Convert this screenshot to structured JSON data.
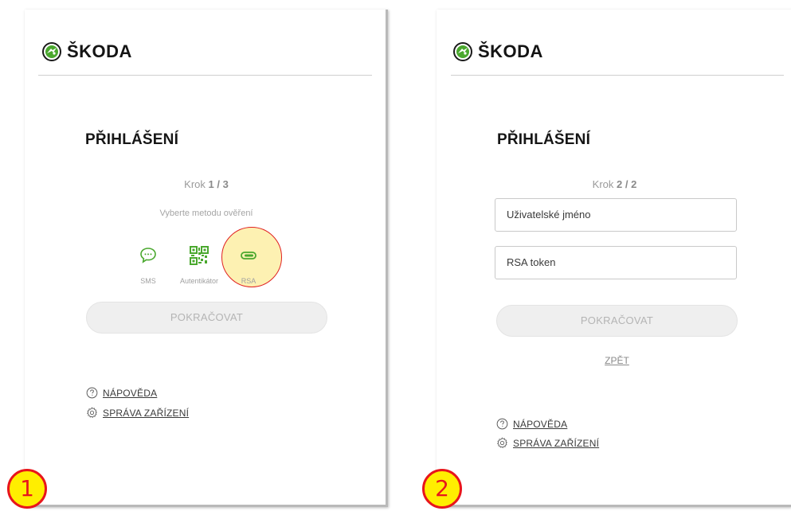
{
  "brand": {
    "name": "ŠKODA",
    "icon": "skoda-winged-arrow-logo",
    "colors": {
      "logo_green": "#3c8a28",
      "text": "#141414"
    }
  },
  "screen1": {
    "title": "PŘIHLÁŠENÍ",
    "step_prefix": "Krok",
    "step_value": "1 / 3",
    "instruction": "Vyberte metodu ověření",
    "methods": [
      {
        "label": "SMS",
        "icon": "chat-bubble-icon"
      },
      {
        "label": "Autentikátor",
        "icon": "qr-code-icon"
      },
      {
        "label": "RSA",
        "icon": "toggle-token-icon"
      }
    ],
    "continue_label": "POKRAČOVAT",
    "help_label": "NÁPOVĚDA",
    "devices_label": "SPRÁVA ZAŘÍZENÍ",
    "marker": "1"
  },
  "screen2": {
    "title": "PŘIHLÁŠENÍ",
    "step_prefix": "Krok",
    "step_value": "2 / 2",
    "username_placeholder": "Uživatelské jméno",
    "rsa_placeholder": "RSA token",
    "continue_label": "POKRAČOVAT",
    "back_label": "ZPĚT",
    "help_label": "NÁPOVĚDA",
    "devices_label": "SPRÁVA ZAŘÍZENÍ",
    "marker": "2"
  },
  "colors": {
    "accent_green": "#4aa82e",
    "highlight_fill": "#fdf0aa",
    "marker_fill": "#ffee00",
    "marker_border": "#e8151b"
  }
}
